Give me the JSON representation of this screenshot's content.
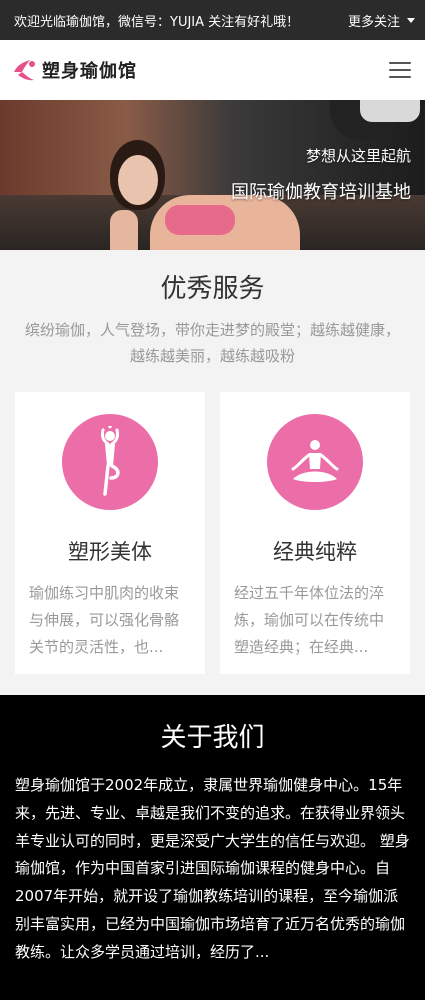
{
  "topbar": {
    "welcome": "欢迎光临瑜伽馆，微信号：YUJIA 关注有好礼哦！",
    "more": "更多关注"
  },
  "navbar": {
    "brand": "塑身瑜伽馆",
    "brand_color": "#e8508a"
  },
  "banner": {
    "line1": "梦想从这里起航",
    "line2": "国际瑜伽教育培训基地"
  },
  "services": {
    "title": "优秀服务",
    "desc": "缤纷瑜伽，人气登场，带你走进梦的殿堂；越练越健康，越练越美丽，越练越吸粉",
    "cards": [
      {
        "icon": "yoga-pose-icon",
        "title": "塑形美体",
        "text": "瑜伽练习中肌肉的收束与伸展，可以强化骨骼关节的灵活性，也..."
      },
      {
        "icon": "meditation-icon",
        "title": "经典纯粹",
        "text": "经过五千年体位法的淬炼，瑜伽可以在传统中塑造经典；在经典..."
      }
    ]
  },
  "about": {
    "title": "关于我们",
    "text": "塑身瑜伽馆于2002年成立，隶属世界瑜伽健身中心。15年来，先进、专业、卓越是我们不变的追求。在获得业界领头羊专业认可的同时，更是深受广大学生的信任与欢迎。 塑身瑜伽馆，作为中国首家引进国际瑜伽课程的健身中心。自2007年开始，就开设了瑜伽教练培训的课程，至今瑜伽派别丰富实用，已经为中国瑜伽市场培育了近万名优秀的瑜伽教练。让众多学员通过培训，经历了..."
  },
  "colors": {
    "accent": "#ec6ea8",
    "topbar": "#2b2b2b",
    "about_bg": "#000000"
  }
}
